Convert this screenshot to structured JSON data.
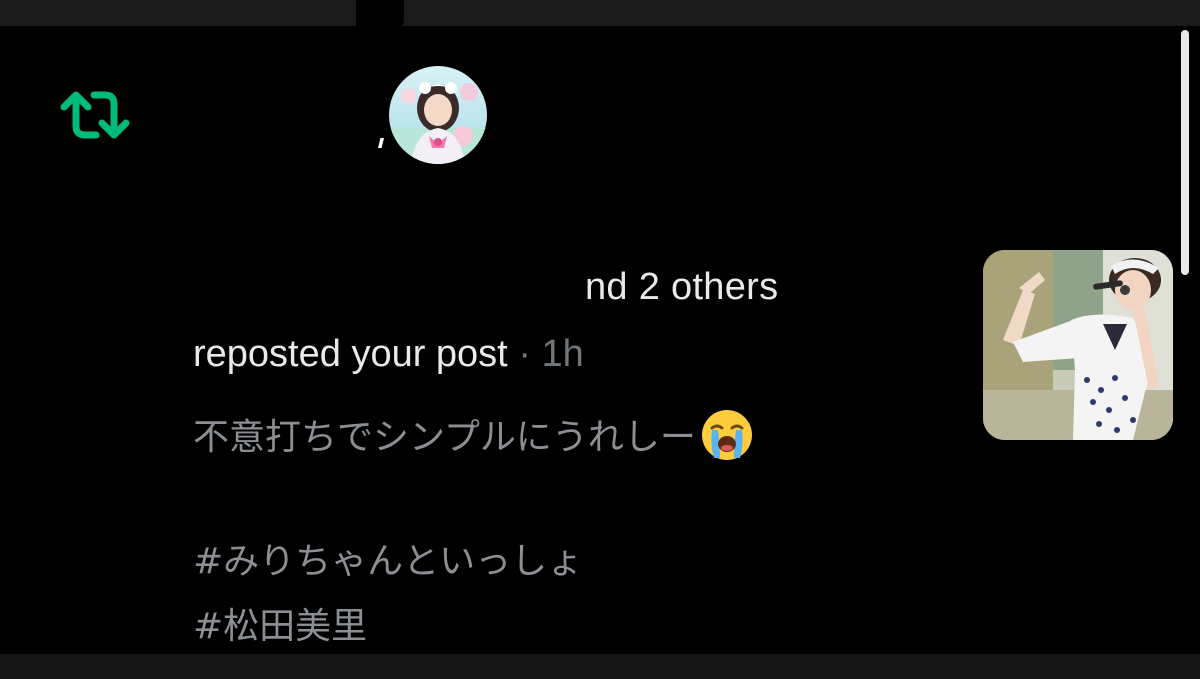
{
  "notification": {
    "type_icon": "repost-icon",
    "headline_suffix": "nd 2 others",
    "action_text": "reposted your post",
    "separator": "·",
    "timestamp": "1h",
    "post_text": "不意打ちでシンプルにうれしー",
    "emoji": "loudly-crying-face",
    "hashtags": [
      "#みりちゃんといっしょ",
      "#松田美里"
    ]
  },
  "colors": {
    "background": "#000000",
    "repost_green": "#00ba7c",
    "primary_text": "#e7e9ea",
    "secondary_text": "#71767b"
  }
}
